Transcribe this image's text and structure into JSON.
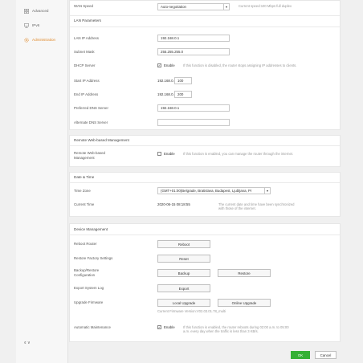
{
  "sidebar": {
    "items": [
      {
        "label": "Advanced",
        "icon": "grid-icon"
      },
      {
        "label": "IPv6",
        "icon": "network-icon"
      },
      {
        "label": "Administration",
        "icon": "gear-icon"
      }
    ],
    "language": "¢ ∨"
  },
  "wan": {
    "speed_label": "WAN Speed",
    "speed_value": "Auto-negotiation",
    "speed_hint": "Current speed:100 Mbps full duplex"
  },
  "lan": {
    "title": "LAN Parameters",
    "ip_label": "LAN IP Address",
    "ip_value": "192.168.0.1",
    "mask_label": "Subnet Mask",
    "mask_value": "255.255.255.0",
    "dhcp_label": "DHCP Server",
    "dhcp_enable": "Enable",
    "dhcp_hint": "If this function is disabled, the router stops assigning IP addresses to clients.",
    "start_label": "Start IP Address",
    "start_prefix": "192.168.0.",
    "start_value": "100",
    "end_label": "End IP Address",
    "end_prefix": "192.168.0.",
    "end_value": "200",
    "pdns_label": "Preferred DNS Server",
    "pdns_value": "192.168.0.1",
    "adns_label": "Alternate DNS Server",
    "adns_value": ""
  },
  "remote": {
    "title": "Remote Web-based Management",
    "label_line1": "Remote Web-based",
    "label_line2": "Management",
    "enable": "Enable",
    "hint": "If this function is enabled, you can manage the router through the internet."
  },
  "datetime": {
    "title": "Date & Time",
    "zone_label": "Time Zone",
    "zone_value": "(GMT+01:00)Belgrade, Bratislava, Budapest, Ljubljana, Pr",
    "current_label": "Current Time",
    "current_value": "2020-06-15 08:18:55",
    "current_hint_line1": "The current date and time have been synchronized",
    "current_hint_line2": "with those of the internet."
  },
  "device": {
    "title": "Device Management",
    "reboot_label": "Reboot Router",
    "reboot_btn": "Reboot",
    "reset_label": "Restore Factory Settings",
    "reset_btn": "Reset",
    "backup_label_line1": "Backup/Restore",
    "backup_label_line2": "Configuration",
    "backup_btn": "Backup",
    "restore_btn": "Restore",
    "export_label": "Export System Log",
    "export_btn": "Export",
    "upgrade_label": "Upgrade Firmware",
    "local_upgrade_btn": "Local Upgrade",
    "online_upgrade_btn": "Online Upgrade",
    "firmware_version": "Current Firmware Version:V02.03.01.78_multi",
    "maint_label": "Automatic Maintenance",
    "maint_enable": "Enable",
    "maint_hint_line1": "If this function is enabled, the router reboots during 02:00 a.m. to 05:00",
    "maint_hint_line2": "a.m. every day when the traffic is less than 3 KB/s."
  },
  "footer": {
    "ok": "OK",
    "cancel": "Cancel"
  },
  "colors": {
    "accent": "#e08a2c",
    "ok_green": "#35b035"
  }
}
